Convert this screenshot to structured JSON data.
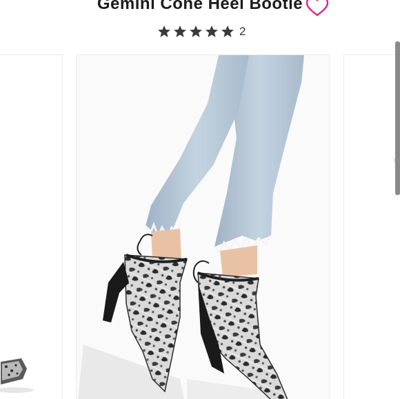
{
  "product": {
    "title": "Gemini Cone Heel Bootie",
    "rating_stars": 5,
    "review_count": "2"
  },
  "icons": {
    "wishlist": "heart-outline-icon",
    "rating": "star-icon"
  },
  "colors": {
    "accent": "#e0218a",
    "star": "#3a3a3a",
    "title": "#1c1c1c"
  }
}
